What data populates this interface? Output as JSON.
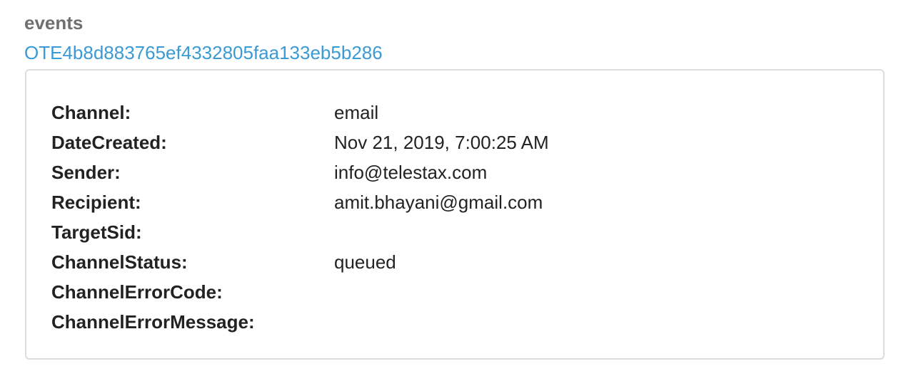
{
  "section": {
    "label": "events"
  },
  "event": {
    "id_link": "OTE4b8d883765ef4332805faa133eb5b286",
    "properties": [
      {
        "key": "Channel:",
        "value": "email"
      },
      {
        "key": "DateCreated:",
        "value": "Nov 21, 2019, 7:00:25 AM"
      },
      {
        "key": "Sender:",
        "value": "info@telestax.com"
      },
      {
        "key": "Recipient:",
        "value": "amit.bhayani@gmail.com"
      },
      {
        "key": "TargetSid:",
        "value": ""
      },
      {
        "key": "ChannelStatus:",
        "value": "queued"
      },
      {
        "key": "ChannelErrorCode:",
        "value": ""
      },
      {
        "key": "ChannelErrorMessage:",
        "value": ""
      }
    ]
  },
  "colors": {
    "link": "#3a9ad6",
    "label": "#707070",
    "border": "#dddddd",
    "text": "#222222"
  }
}
